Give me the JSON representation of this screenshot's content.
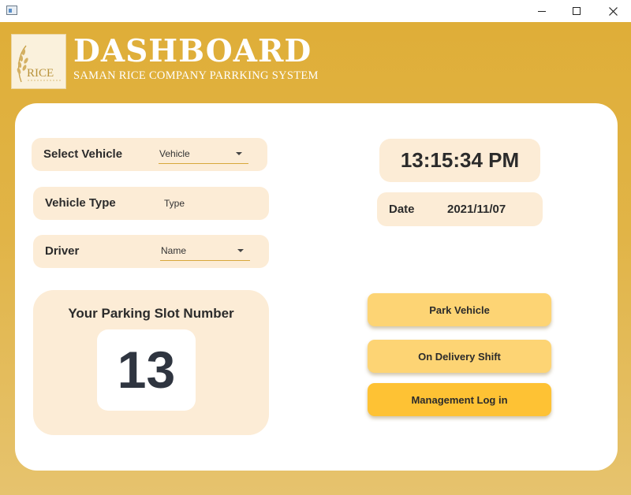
{
  "window": {
    "controls": {
      "minimize": "minimize",
      "maximize": "maximize",
      "close": "close"
    }
  },
  "header": {
    "logo_text": "RICE",
    "title": "DASHBOARD",
    "subtitle": "SAMAN RICE COMPANY PARRKING SYSTEM"
  },
  "form": {
    "select_vehicle": {
      "label": "Select Vehicle",
      "value": "Vehicle"
    },
    "vehicle_type": {
      "label": "Vehicle Type",
      "value": "Type"
    },
    "driver": {
      "label": "Driver",
      "value": "Name"
    }
  },
  "parking_slot": {
    "title": "Your Parking Slot Number",
    "number": "13"
  },
  "clock": {
    "time": "13:15:34 PM"
  },
  "date": {
    "label": "Date",
    "value": "2021/11/07"
  },
  "actions": {
    "park_vehicle": "Park Vehicle",
    "on_delivery_shift": "On Delivery Shift",
    "management_login": "Management Log in"
  },
  "colors": {
    "background_top": "#dfae38",
    "background_bottom": "#e6c36e",
    "panel": "#fcecd6",
    "button": "#fdd474",
    "button_primary": "#fec234",
    "accent_underline": "#d7a73a"
  }
}
